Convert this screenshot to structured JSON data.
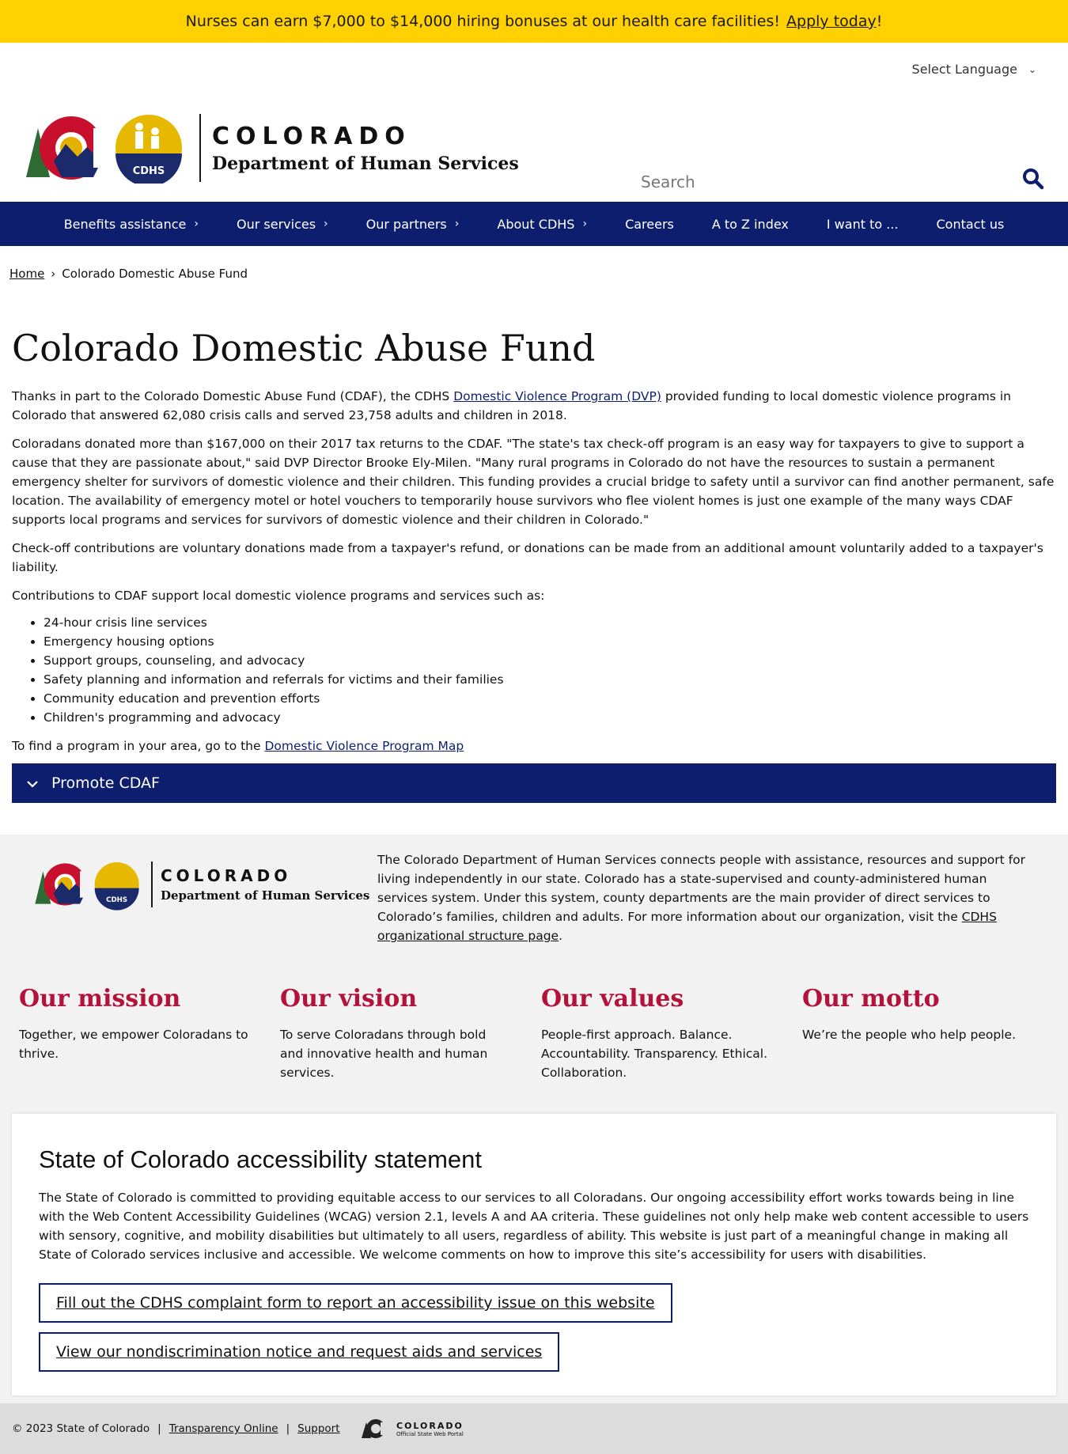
{
  "alert": {
    "text": "Nurses can earn $7,000 to $14,000 hiring bonuses at our health care facilities!",
    "link": "Apply today",
    "suffix": "!"
  },
  "header": {
    "language_label": "Select Language",
    "logo_colorado": "COLORADO",
    "logo_dept": "Department of Human Services",
    "logo_badge": "CDHS",
    "search_placeholder": "Search"
  },
  "nav": {
    "items": [
      {
        "label": "Benefits assistance",
        "has_submenu": true
      },
      {
        "label": "Our services",
        "has_submenu": true
      },
      {
        "label": "Our partners",
        "has_submenu": true
      },
      {
        "label": "About CDHS",
        "has_submenu": true
      },
      {
        "label": "Careers",
        "has_submenu": false
      },
      {
        "label": "A to Z index",
        "has_submenu": false
      },
      {
        "label": "I want to ...",
        "has_submenu": false
      },
      {
        "label": "Contact us",
        "has_submenu": false
      }
    ]
  },
  "breadcrumb": {
    "home": "Home",
    "separator": "›",
    "current": "Colorado Domestic Abuse Fund"
  },
  "main": {
    "title": "Colorado Domestic Abuse Fund",
    "p1_before": "Thanks in part to the Colorado Domestic Abuse Fund (CDAF), the CDHS",
    "p1_link": "Domestic Violence Program (DVP)",
    "p1_after": "provided funding to local domestic violence programs in Colorado that answered 62,080 crisis calls and served 23,758 adults and children in 2018.",
    "p2": "Coloradans donated more than $167,000 on their 2017 tax returns to the CDAF. \"The state's tax check-off program is an easy way for taxpayers to give to support a cause that they are passionate about,\" said DVP Director Brooke Ely-Milen. \"Many rural programs in Colorado do not have the resources to sustain a permanent emergency shelter for survivors of domestic violence and their children. This funding provides a crucial bridge to safety until a survivor can find another permanent, safe location. The availability of emergency motel or hotel vouchers to temporarily house survivors who flee violent homes is just one example of the many ways CDAF supports local programs and services for survivors of domestic violence and their children in Colorado.\"",
    "p3": "Check-off contributions are voluntary donations made from a taxpayer's refund, or donations can be made from an additional amount voluntarily added to a taxpayer's liability.",
    "p4": "Contributions to CDAF support local domestic violence programs and services such as:",
    "services": [
      "24-hour crisis line services",
      "Emergency housing options",
      "Support groups, counseling, and advocacy",
      "Safety planning and information and referrals for victims and their families",
      "Community education and prevention efforts",
      "Children's programming and advocacy"
    ],
    "p5_before": "To find a program in your area, go to the",
    "p5_link": "Domestic Violence Program Map",
    "accordion_label": "Promote CDAF"
  },
  "footer": {
    "desc_before": "The Colorado Department of Human Services connects people with assistance, resources and support for living independently in our state. Colorado has a state-supervised and county-administered human services system. Under this system, county departments are the main provider of direct services to Colorado’s families, children and adults. For more information about our organization, visit the",
    "desc_link": "CDHS organizational structure page",
    "desc_after": ".",
    "columns": [
      {
        "heading": "Our mission",
        "text": "Together, we empower Coloradans to thrive."
      },
      {
        "heading": "Our vision",
        "text": "To serve Coloradans through bold and innovative health and human services."
      },
      {
        "heading": "Our values",
        "text": "People-first approach. Balance. Accountability. Transparency. Ethical. Collaboration."
      },
      {
        "heading": "Our motto",
        "text": "We’re the people who help people."
      }
    ],
    "a11y": {
      "heading": "State of Colorado accessibility statement",
      "text": "The State of Colorado is committed to providing equitable access to our services to all Coloradans. Our ongoing accessibility effort works towards being in line with the Web Content Accessibility Guidelines (WCAG) version 2.1, levels A and AA criteria. These guidelines not only help make web content accessible to users with sensory, cognitive, and mobility disabilities but ultimately to all users, regardless of ability. This website is just part of a meaningful change in making all State of Colorado services inclusive and accessible. We welcome comments on how to improve this site’s accessibility for users with disabilities.",
      "button1": "Fill out the CDHS complaint form to report an accessibility issue on this website",
      "button2": "View our nondiscrimination notice and request aids and services"
    },
    "bottom": {
      "copyright": "© 2023 State of Colorado",
      "sep": "|",
      "link1": "Transparency Online",
      "link2": "Support",
      "portal_title": "COLORADO",
      "portal_sub": "Official State Web Portal"
    }
  },
  "colors": {
    "alert_bg": "#ffd100",
    "nav_bg": "#0d1e6f",
    "accent_red": "#b3123a",
    "footer_bg": "#f2f2f2"
  }
}
